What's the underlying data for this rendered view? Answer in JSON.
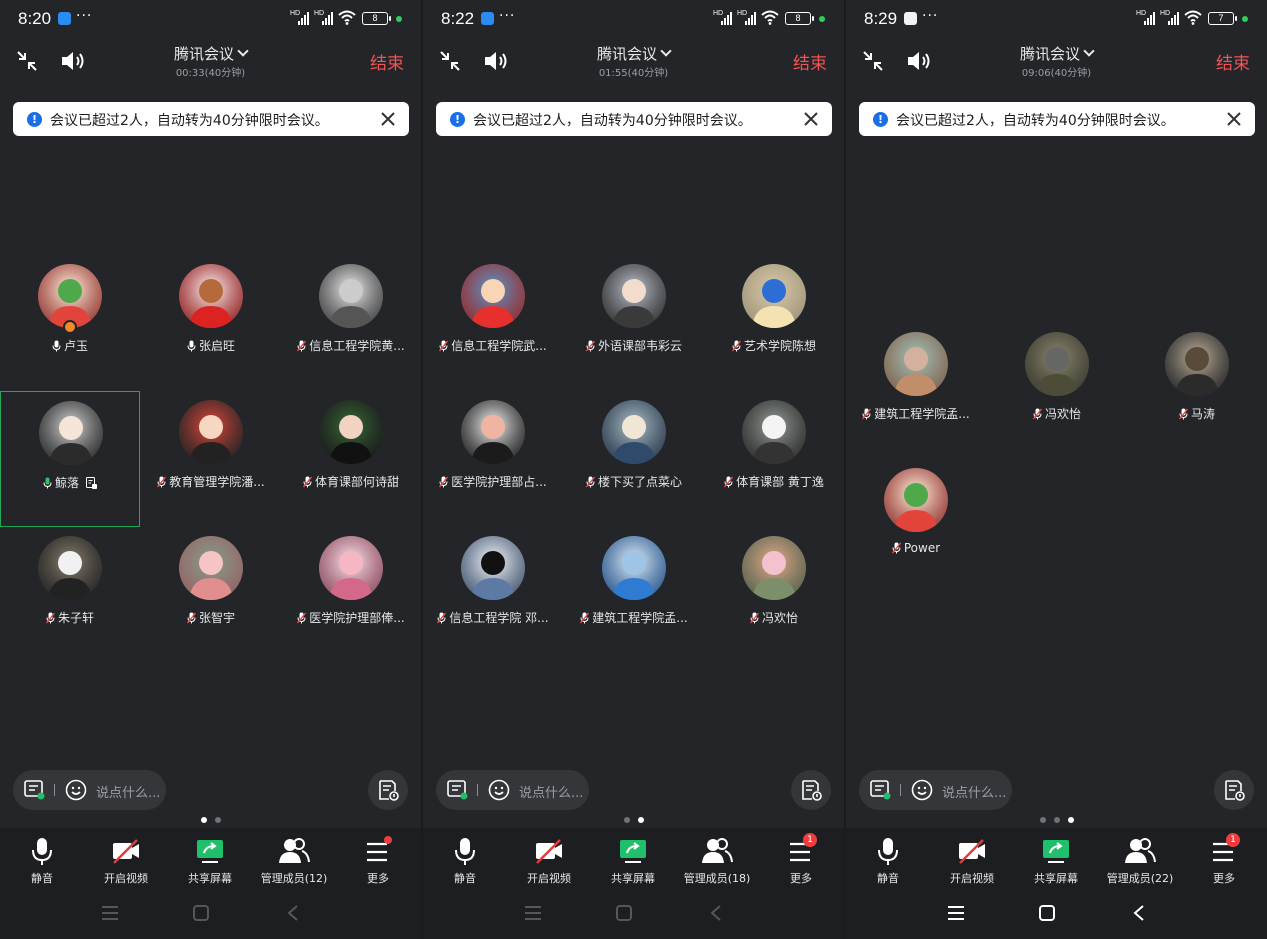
{
  "panels": [
    {
      "status": {
        "time": "8:20",
        "battery": "8",
        "app_icon_color": "#2a8cf0"
      },
      "meeting": {
        "title": "腾讯会议",
        "duration": "00:33(40分钟)",
        "end_label": "结束"
      },
      "notice": {
        "text": "会议已超过2人，自动转为40分钟限时会议。"
      },
      "participants": [
        {
          "name": "卢玉",
          "mic": "on",
          "host": true
        },
        {
          "name": "张启旺",
          "mic": "on"
        },
        {
          "name": "信息工程学院黄...",
          "mic": "muted"
        },
        {
          "name": "鲸落",
          "mic": "speaking",
          "active": true,
          "sharing_doc": true
        },
        {
          "name": "教育管理学院潘...",
          "mic": "muted"
        },
        {
          "name": "体育课部何诗甜",
          "mic": "muted"
        },
        {
          "name": "朱子轩",
          "mic": "muted"
        },
        {
          "name": "张智宇",
          "mic": "muted"
        },
        {
          "name": "医学院护理部俸...",
          "mic": "muted"
        }
      ],
      "chat_placeholder": "说点什么...",
      "page_indicator": {
        "total": 2,
        "current": 1
      },
      "toolbar": {
        "mute": "静音",
        "video": "开启视频",
        "share": "共享屏幕",
        "members": "管理成员(12)",
        "more": "更多",
        "more_badge": ""
      },
      "nav_dimmed": true
    },
    {
      "status": {
        "time": "8:22",
        "battery": "8",
        "app_icon_color": "#2a8cf0"
      },
      "meeting": {
        "title": "腾讯会议",
        "duration": "01:55(40分钟)",
        "end_label": "结束"
      },
      "notice": {
        "text": "会议已超过2人，自动转为40分钟限时会议。"
      },
      "participants": [
        {
          "name": "信息工程学院武...",
          "mic": "muted"
        },
        {
          "name": "外语课部韦彩云",
          "mic": "muted"
        },
        {
          "name": "艺术学院陈想",
          "mic": "muted"
        },
        {
          "name": "医学院护理部占...",
          "mic": "muted"
        },
        {
          "name": "楼下买了点菜心",
          "mic": "muted"
        },
        {
          "name": "体育课部 黄丁逸",
          "mic": "muted"
        },
        {
          "name": "信息工程学院 邓...",
          "mic": "muted"
        },
        {
          "name": "建筑工程学院孟...",
          "mic": "muted"
        },
        {
          "name": "冯欢怡",
          "mic": "muted"
        }
      ],
      "chat_placeholder": "说点什么...",
      "page_indicator": {
        "total": 2,
        "current": 2
      },
      "toolbar": {
        "mute": "静音",
        "video": "开启视频",
        "share": "共享屏幕",
        "members": "管理成员(18)",
        "more": "更多",
        "more_badge": "1"
      },
      "nav_dimmed": true
    },
    {
      "status": {
        "time": "8:29",
        "battery": "7",
        "app_icon_color": "#f2f2f2"
      },
      "meeting": {
        "title": "腾讯会议",
        "duration": "09:06(40分钟)",
        "end_label": "结束"
      },
      "notice": {
        "text": "会议已超过2人，自动转为40分钟限时会议。"
      },
      "participants": [
        {
          "name": "建筑工程学院孟...",
          "mic": "muted"
        },
        {
          "name": "冯欢怡",
          "mic": "muted"
        },
        {
          "name": "马涛",
          "mic": "muted"
        },
        {
          "name": "Power",
          "mic": "muted"
        }
      ],
      "chat_placeholder": "说点什么...",
      "page_indicator": {
        "total": 3,
        "current": 3
      },
      "toolbar": {
        "mute": "静音",
        "video": "开启视频",
        "share": "共享屏幕",
        "members": "管理成员(22)",
        "more": "更多",
        "more_badge": "1"
      },
      "nav_dimmed": false
    }
  ],
  "colors": {
    "end": "#f25353",
    "active_border": "#1fa85a",
    "share_green": "#1fbf6b",
    "badge_red": "#f03e3e"
  },
  "icons": [
    "collapse-icon",
    "speaker-icon",
    "chevron-down-icon",
    "info-icon",
    "close-icon",
    "mic-icon",
    "mic-muted-icon",
    "host-badge-icon",
    "doc-share-icon",
    "chat-icon",
    "emoji-icon",
    "notes-icon",
    "camera-off-icon",
    "share-screen-icon",
    "members-icon",
    "more-menu-icon",
    "nav-menu-icon",
    "nav-home-icon",
    "nav-back-icon"
  ]
}
